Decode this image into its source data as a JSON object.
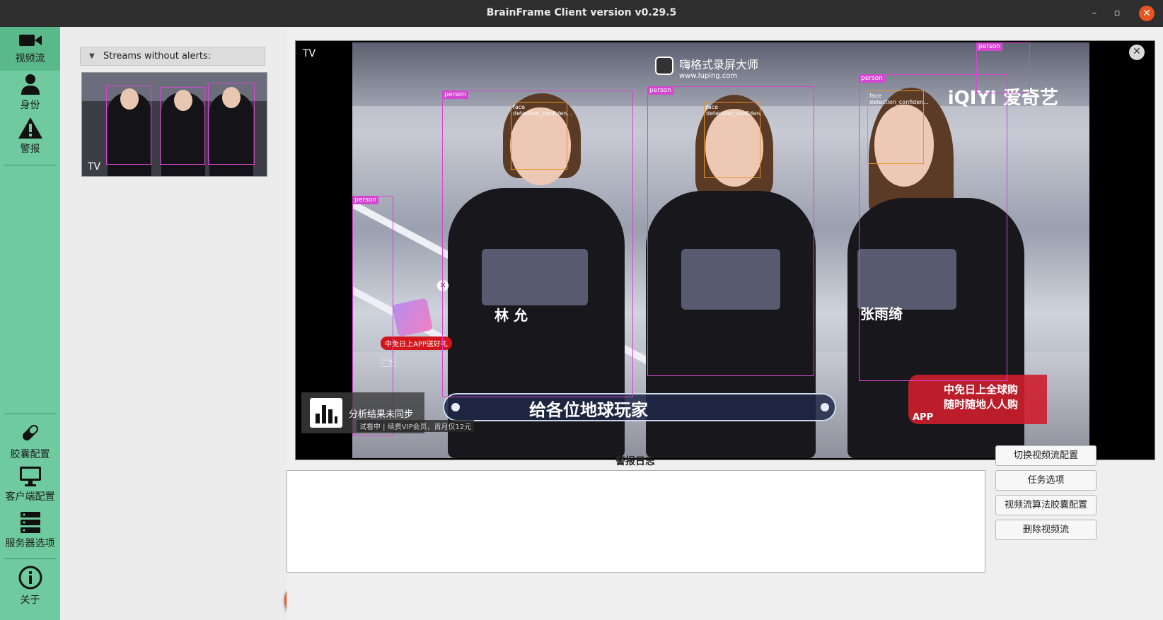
{
  "window": {
    "title": "BrainFrame Client version v0.29.5",
    "minimize": "–",
    "maximize": "▫",
    "close": "✕"
  },
  "sidebar": {
    "top_items": [
      {
        "label": "视频流",
        "icon": "video-camera-icon"
      },
      {
        "label": "身份",
        "icon": "person-icon"
      },
      {
        "label": "警报",
        "icon": "warning-icon"
      }
    ],
    "bottom_items": [
      {
        "label": "胶囊配置",
        "icon": "capsule-icon"
      },
      {
        "label": "客户端配置",
        "icon": "monitor-icon"
      },
      {
        "label": "服务器选项",
        "icon": "server-icon"
      },
      {
        "label": "关于",
        "icon": "info-icon"
      }
    ],
    "accent": "#6fcb9f"
  },
  "stream_list": {
    "group_label": "Streams without alerts:",
    "streams": [
      {
        "name": "TV"
      }
    ],
    "add_label": "+"
  },
  "video": {
    "stream_name": "TV",
    "close": "✕",
    "recorder_watermark": "嗨格式录屏大师",
    "recorder_url": "www.luping.com",
    "channel_logo": "iQIYI 爱奇艺",
    "subtitle": "给各位地球玩家",
    "promo_badge": "中免日上APP送好礼",
    "ad_tag": "广告",
    "red_logo_line1": "中免日上全球购",
    "red_logo_line2": "随时随地人人购",
    "red_logo_app": "APP",
    "name_tag_1": "林 允",
    "name_tag_2": "张雨绮",
    "analysis_status": "分析结果未同步",
    "vip_line": "试看中 | 续费VIP会员，首月仅12元",
    "detections": [
      {
        "label": "person"
      },
      {
        "label": "person"
      },
      {
        "label": "person"
      },
      {
        "label": "person"
      },
      {
        "label": "person"
      },
      {
        "label": "face\ndetection_confiden..."
      },
      {
        "label": "face\ndetection_confiden..."
      },
      {
        "label": "face\ndetection_confiden..."
      }
    ]
  },
  "alert_log": {
    "title": "警报日志"
  },
  "actions": {
    "switch_config": "切换视频流配置",
    "task_options": "任务选项",
    "capsule_config": "视频流算法胶囊配置",
    "delete_stream": "删除视频流"
  },
  "colors": {
    "add_button": "#e95420",
    "person_box": "#d447d0",
    "face_box": "#e8962b"
  }
}
